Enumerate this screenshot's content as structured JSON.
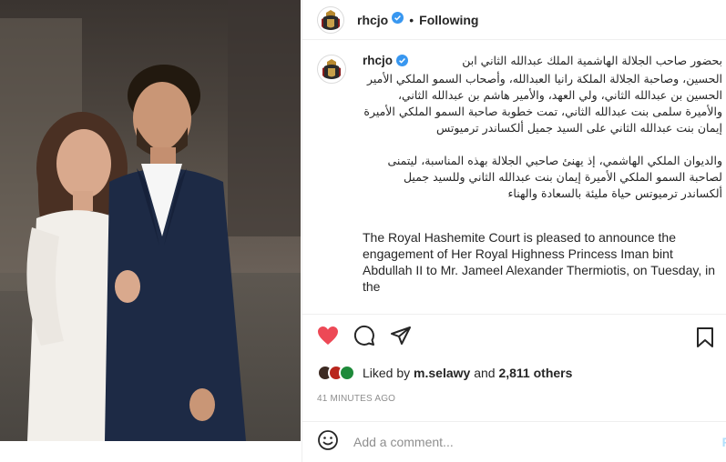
{
  "post": {
    "username": "rhcjo",
    "follow_label": "Following",
    "dot": "•"
  },
  "caption": {
    "username": "rhcjo",
    "arabic_p1_first": "بحضور صاحب الجلالة الهاشمية الملك عبدالله الثاني ابن",
    "arabic_p1_rest": "الحسين، وصاحبة الجلالة الملكة رانيا العبدالله، وأصحاب السمو الملكي الأمير الحسين بن عبدالله الثاني، ولي العهد، والأمير هاشم بن عبدالله الثاني، والأميرة سلمى بنت عبدالله الثاني، تمت خطوبة صاحبة السمو الملكي الأميرة إيمان بنت عبدالله الثاني على السيد جميل ألكساندر ترميوتس",
    "arabic_p2": "والديوان الملكي الهاشمي، إذ يهنئ صاحبي الجلالة بهذه المناسبة، ليتمنى لصاحبة السمو الملكي الأميرة إيمان بنت عبدالله الثاني وللسيد جميل ألكساندر ترميوتس حياة مليئة بالسعادة والهناء",
    "english": "The Royal Hashemite Court is pleased to announce the engagement of Her Royal Highness Princess Iman bint Abdullah II to Mr. Jameel Alexander Thermiotis, on Tuesday, in the"
  },
  "actions": {
    "like_icon": "heart-icon",
    "comment_icon": "comment-icon",
    "share_icon": "share-icon",
    "save_icon": "bookmark-icon",
    "like_color": "#ed4956"
  },
  "likes": {
    "prefix": "Liked by",
    "user": "m.selawy",
    "and": "and",
    "others": "2,811 others"
  },
  "time": "41 MINUTES AGO",
  "comment": {
    "placeholder": "Add a comment...",
    "post_label": "P"
  }
}
